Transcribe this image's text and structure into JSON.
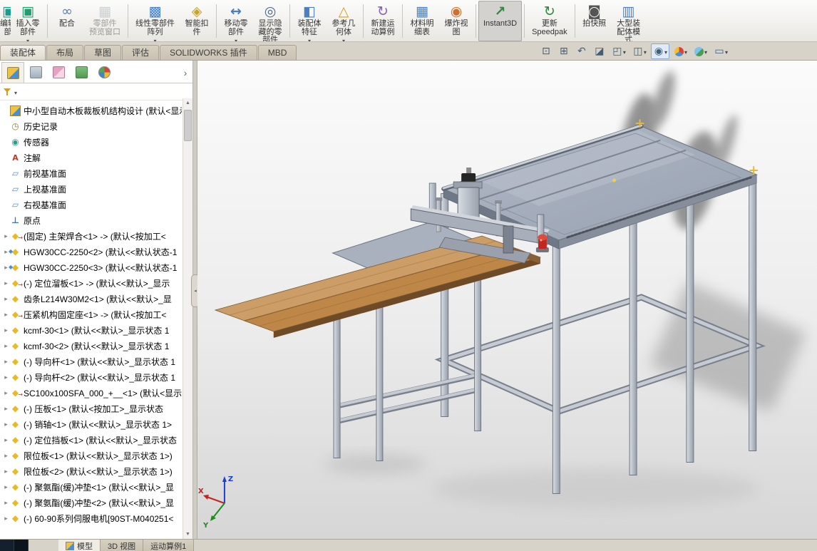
{
  "app": {
    "name": "SOLIDWORKS"
  },
  "colors": {
    "ribbon_tab": "#d0c9b9",
    "active_button_bg": "#d3d2cf",
    "deck_gray": "#a0a9b8",
    "wood_light": "#cc9d66",
    "wood_dark": "#bf8747",
    "beacon_red": "#c1271f",
    "marker_yellow": "#e8c93e"
  },
  "command_manager": {
    "buttons": [
      {
        "name": "edit-component",
        "icon": "edit-component",
        "lines": [
          "编辑零",
          "部件"
        ],
        "partial": true
      },
      {
        "name": "insert-components",
        "icon": "insert-component",
        "lines": [
          "插入零",
          "部件"
        ],
        "dropdown": true,
        "sep": true
      },
      {
        "name": "mate",
        "icon": "mate",
        "lines": [
          "配合"
        ]
      },
      {
        "name": "component-preview-window",
        "icon": "preview",
        "lines": [
          "零部件",
          "预览窗口"
        ],
        "disabled": true,
        "sep": true
      },
      {
        "name": "linear-component-pattern",
        "icon": "pattern",
        "lines": [
          "线性零部件",
          "阵列"
        ],
        "dropdown": true
      },
      {
        "name": "smart-fasteners",
        "icon": "fastener",
        "lines": [
          "智能扣",
          "件"
        ],
        "sep": true
      },
      {
        "name": "move-component",
        "icon": "move",
        "lines": [
          "移动零",
          "部件"
        ],
        "dropdown": true
      },
      {
        "name": "show-hidden-components",
        "icon": "show-hidden",
        "lines": [
          "显示隐",
          "藏的零",
          "部件"
        ],
        "sep": true
      },
      {
        "name": "assembly-features",
        "icon": "asm-features",
        "lines": [
          "装配体",
          "特征"
        ],
        "dropdown": true
      },
      {
        "name": "reference-geometry",
        "icon": "ref-geometry",
        "lines": [
          "参考几",
          "何体"
        ],
        "dropdown": true,
        "sep": true
      },
      {
        "name": "new-motion-study",
        "icon": "motion",
        "lines": [
          "新建运",
          "动算例"
        ],
        "sep": true
      },
      {
        "name": "bill-of-materials",
        "icon": "bom",
        "lines": [
          "材料明",
          "细表"
        ]
      },
      {
        "name": "exploded-view",
        "icon": "explode",
        "lines": [
          "爆炸视",
          "图"
        ],
        "sep": true
      },
      {
        "name": "instant3d",
        "icon": "instant3d",
        "lines": [
          "Instant3D"
        ],
        "active": true,
        "sep": true
      },
      {
        "name": "update-speedpak",
        "icon": "speedpak",
        "lines": [
          "更新",
          "Speedpak"
        ],
        "sep": true
      },
      {
        "name": "take-snapshot",
        "icon": "snapshot",
        "lines": [
          "拍快照"
        ]
      },
      {
        "name": "large-assembly-mode",
        "icon": "large-asm",
        "lines": [
          "大型装",
          "配体模",
          "式"
        ]
      }
    ]
  },
  "ribbon_tabs": [
    {
      "name": "tab-assembly",
      "label": "装配体",
      "active": true
    },
    {
      "name": "tab-layout",
      "label": "布局"
    },
    {
      "name": "tab-sketch",
      "label": "草图"
    },
    {
      "name": "tab-evaluate",
      "label": "评估"
    },
    {
      "name": "tab-solidworks-addins",
      "label": "SOLIDWORKS 插件"
    },
    {
      "name": "tab-mbd",
      "label": "MBD"
    }
  ],
  "headsup": [
    {
      "name": "zoom-fit",
      "glyph": "⊡"
    },
    {
      "name": "zoom-to-area",
      "glyph": "⊞"
    },
    {
      "name": "previous-view",
      "glyph": "↶"
    },
    {
      "name": "section-view",
      "glyph": "◪"
    },
    {
      "name": "view-orientation",
      "glyph": "◰",
      "dropdown": true
    },
    {
      "name": "display-style",
      "glyph": "◫",
      "dropdown": true
    },
    {
      "name": "hide-show-items",
      "glyph": "◉",
      "dropdown": true,
      "pressed": true
    },
    {
      "name": "edit-appearance",
      "ball": "appearance",
      "dropdown": true
    },
    {
      "name": "apply-scene",
      "ball": "scene",
      "dropdown": true
    },
    {
      "name": "view-settings",
      "glyph": "▭",
      "dropdown": true
    }
  ],
  "feature_panel": {
    "tabs": [
      {
        "name": "featuremanager-tab",
        "icon": "featuremanager",
        "active": true
      },
      {
        "name": "propertymanager-tab",
        "icon": "propertymanager"
      },
      {
        "name": "configurationmanager-tab",
        "icon": "configurationmanager"
      },
      {
        "name": "dimxpertmanager-tab",
        "icon": "dimxpertmanager"
      },
      {
        "name": "displaymanager-tab",
        "icon": "displaymanager"
      }
    ],
    "items": [
      {
        "icon": "assembly",
        "label": "中小型自动木板裁板机结构设计 (默认<显示状",
        "expandable": false
      },
      {
        "icon": "history",
        "label": "历史记录",
        "expandable": false
      },
      {
        "icon": "sensor",
        "label": "传感器",
        "expandable": false
      },
      {
        "icon": "annotation",
        "label": "注解",
        "expandable": false
      },
      {
        "icon": "plane",
        "label": "前视基准面",
        "expandable": false
      },
      {
        "icon": "plane",
        "label": "上视基准面",
        "expandable": false
      },
      {
        "icon": "plane",
        "label": "右视基准面",
        "expandable": false
      },
      {
        "icon": "origin",
        "label": "原点",
        "expandable": false
      },
      {
        "icon": "part-ext",
        "label": "(固定) 主架焊合<1> -> (默认<按加工<",
        "expandable": true
      },
      {
        "icon": "subasm",
        "label": "HGW30CC-2250<2> (默认<<默认状态-1",
        "expandable": true
      },
      {
        "icon": "subasm",
        "label": "HGW30CC-2250<3> (默认<<默认状态-1",
        "expandable": true
      },
      {
        "icon": "part-ext",
        "label": "(-) 定位溜板<1> -> (默认<<默认>_显示",
        "expandable": true
      },
      {
        "icon": "part",
        "label": "齿条L214W30M2<1> (默认<<默认>_显",
        "expandable": true
      },
      {
        "icon": "part-ext",
        "label": "压紧机构固定座<1> -> (默认<按加工<",
        "expandable": true
      },
      {
        "icon": "part",
        "label": "kcmf-30<1> (默认<<默认>_显示状态 1",
        "expandable": true
      },
      {
        "icon": "part",
        "label": "kcmf-30<2> (默认<<默认>_显示状态 1",
        "expandable": true
      },
      {
        "icon": "part",
        "label": "(-) 导向杆<1> (默认<<默认>_显示状态 1",
        "expandable": true
      },
      {
        "icon": "part",
        "label": "(-) 导向杆<2> (默认<<默认>_显示状态 1",
        "expandable": true
      },
      {
        "icon": "part-ext",
        "label": "SC100x100SFA_000_+__<1> (默认<显示",
        "expandable": true
      },
      {
        "icon": "part",
        "label": "(-) 压板<1> (默认<按加工>_显示状态",
        "expandable": true
      },
      {
        "icon": "part",
        "label": "(-) 销轴<1> (默认<<默认>_显示状态 1>",
        "expandable": true
      },
      {
        "icon": "part",
        "label": "(-) 定位挡板<1> (默认<<默认>_显示状态",
        "expandable": true
      },
      {
        "icon": "part",
        "label": "限位板<1> (默认<<默认>_显示状态 1>)",
        "expandable": true
      },
      {
        "icon": "part",
        "label": "限位板<2> (默认<<默认>_显示状态 1>)",
        "expandable": true
      },
      {
        "icon": "part",
        "label": "(-) 聚氨酯(缓)冲垫<1> (默认<<默认>_显",
        "expandable": true
      },
      {
        "icon": "part",
        "label": "(-) 聚氨酯(缓)冲垫<2> (默认<<默认>_显",
        "expandable": true
      },
      {
        "icon": "part",
        "label": "(-) 60-90系列伺服电机[90ST-M040251<",
        "expandable": true
      }
    ]
  },
  "viewport": {
    "triad": {
      "x": "X",
      "y": "Y",
      "z": "Z"
    }
  },
  "status_tabs": [
    {
      "name": "model-tab",
      "label": "模型",
      "icon": true,
      "active": true
    },
    {
      "name": "3d-views-tab",
      "label": "3D 视图"
    },
    {
      "name": "motion-study-tab",
      "label": "运动算例1"
    }
  ]
}
